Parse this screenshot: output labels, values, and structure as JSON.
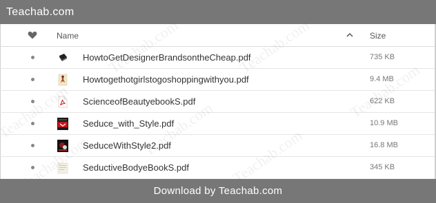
{
  "site": {
    "title": "Teachab.com"
  },
  "columns": {
    "name": "Name",
    "size": "Size"
  },
  "files": [
    {
      "name": "HowtoGetDesignerBrandsontheCheap.pdf",
      "size": "735 KB",
      "thumb": "dark-book-icon"
    },
    {
      "name": "Howtogethotgirlstogoshoppingwithyou.pdf",
      "size": "9.4 MB",
      "thumb": "illustration-thumbnail"
    },
    {
      "name": "ScienceofBeautyebookS.pdf",
      "size": "622 KB",
      "thumb": "pdf-icon"
    },
    {
      "name": "Seduce_with_Style.pdf",
      "size": "10.9 MB",
      "thumb": "red-cover-thumbnail"
    },
    {
      "name": "SeduceWithStyle2.pdf",
      "size": "16.8 MB",
      "thumb": "dark-cover-thumbnail"
    },
    {
      "name": "SeductiveBodyeBookS.pdf",
      "size": "345 KB",
      "thumb": "paper-thumbnail"
    }
  ],
  "download": {
    "label": "Download by Teachab.com"
  },
  "watermark": "Teachab.com",
  "colors": {
    "bar": "#777777",
    "pdf_red": "#d9342b"
  }
}
